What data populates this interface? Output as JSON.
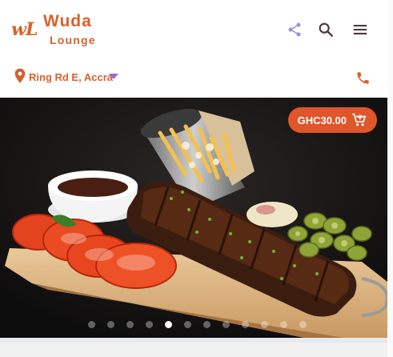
{
  "brand": {
    "logo_mark": "wL",
    "title": "Wuda",
    "subtitle": "Lounge"
  },
  "header_icons": {
    "share": "share-icon",
    "search": "search-icon",
    "menu": "menu-icon",
    "phone": "phone-icon"
  },
  "location": {
    "label": "Ring Rd E, Accra",
    "pin_icon": "location-pin-icon",
    "dropdown_icon": "dropdown-caret-icon"
  },
  "hero": {
    "price": "GHC30.00",
    "cart_icon": "add-to-cart-icon",
    "slide_count": 12,
    "active_slide": 5
  },
  "colors": {
    "accent": "#d9602c",
    "price_badge": "#e0552a",
    "share_icon": "#9c8ed8",
    "dropdown_caret": "#8b6fd8",
    "icon_dark": "#4a3c36"
  }
}
